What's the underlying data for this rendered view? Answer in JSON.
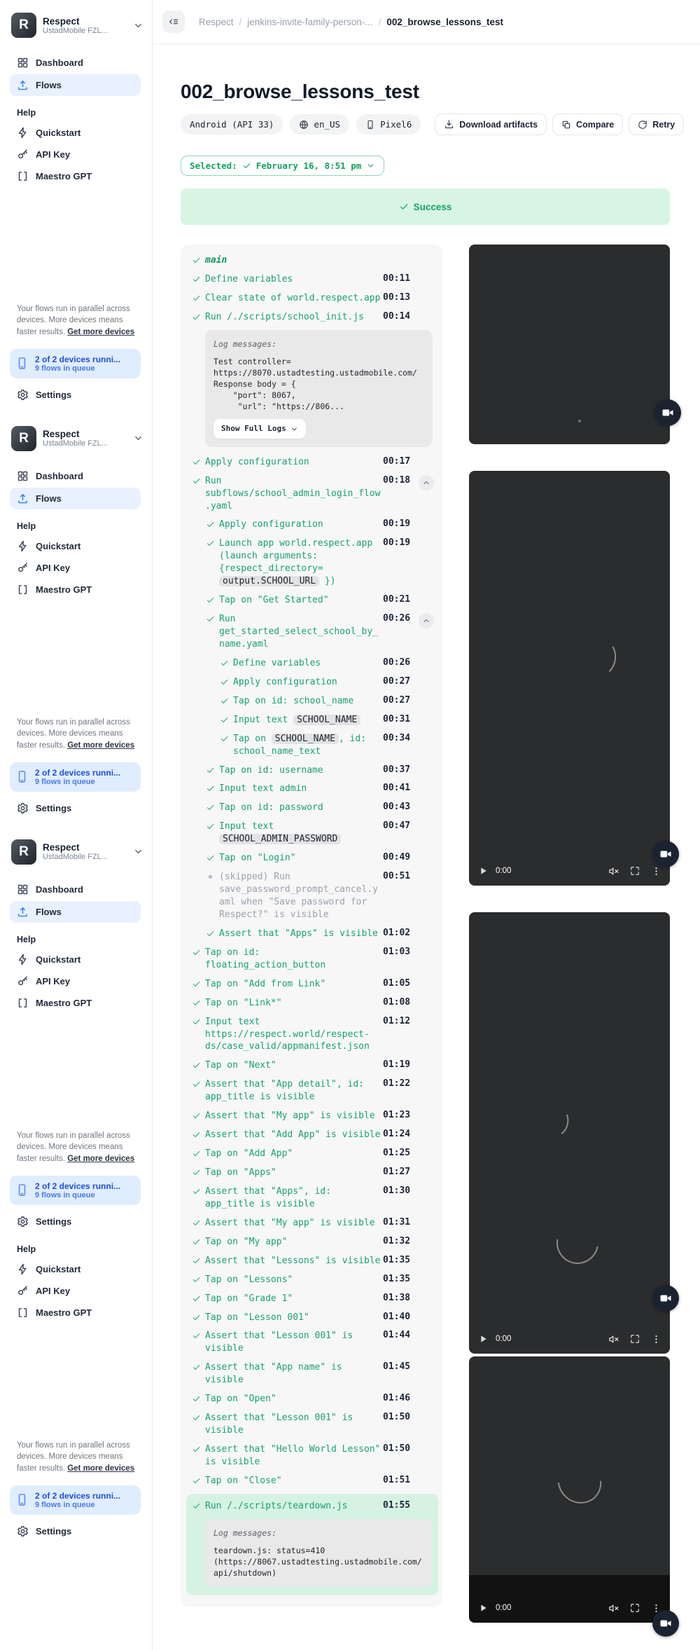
{
  "colors": {
    "accent_green": "#19a172",
    "success_bg": "#d8f5e4",
    "link_blue": "#2f7cf6",
    "device_box_bg": "#e0edfe",
    "flows_pill_bg": "#e8f1fd"
  },
  "sidebar": {
    "org_name": "Respect",
    "org_sub": "UstadMobile FZL...",
    "logo_letter": "R",
    "nav": [
      {
        "label": "Dashboard",
        "icon": "grid",
        "active": false
      },
      {
        "label": "Flows",
        "icon": "upload",
        "active": true
      }
    ],
    "help_label": "Help",
    "help": [
      {
        "label": "Quickstart",
        "icon": "bolt"
      },
      {
        "label": "API Key",
        "icon": "key"
      },
      {
        "label": "Maestro GPT",
        "icon": "brackets"
      }
    ],
    "footer_text": "Your flows run in parallel across devices. More devices means faster results. ",
    "footer_link": "Get more devices",
    "device_title": "2 of 2 devices runni...",
    "device_sub": "9 flows in queue",
    "settings_label": "Settings",
    "blocks": [
      {
        "org": true
      },
      {
        "org": true
      },
      {
        "org": true
      },
      {
        "org": false
      }
    ]
  },
  "breadcrumb": {
    "items": [
      "Respect",
      "jenkins-invite-family-person-...",
      "002_browse_lessons_test"
    ]
  },
  "page": {
    "title": "002_browse_lessons_test",
    "badges": [
      {
        "label": "Android (API 33)",
        "icon": null
      },
      {
        "label": "en_US",
        "icon": "globe"
      },
      {
        "label": "Pixel6",
        "icon": "phone"
      }
    ],
    "actions": [
      {
        "label": "Download artifacts",
        "icon": "download"
      },
      {
        "label": "Compare",
        "icon": "compare"
      },
      {
        "label": "Retry",
        "icon": "retry"
      }
    ],
    "selected_prefix": "Selected:",
    "selected_value": "February 16, 8:51 pm",
    "status_label": "Success"
  },
  "steps": [
    {
      "lv": 0,
      "head": true,
      "text": [
        {
          "t": "main"
        }
      ]
    },
    {
      "lv": 0,
      "text": [
        {
          "t": "Define variables"
        }
      ],
      "time": "00:11"
    },
    {
      "lv": 0,
      "text": [
        {
          "t": "Clear state of world.respect.app"
        }
      ],
      "time": "00:13"
    },
    {
      "lv": 0,
      "text": [
        {
          "t": "Run /./scripts/school_init.js"
        }
      ],
      "time": "00:14",
      "log": {
        "label": "Log messages:",
        "lines": [
          "Test controller=",
          "https://8070.ustadtesting.ustadmobile.com/",
          "Response body = {",
          "    \"port\": 8067,",
          "     \"url\": \"https://806..."
        ],
        "button": "Show Full Logs"
      }
    },
    {
      "lv": 0,
      "text": [
        {
          "t": "Apply configuration"
        }
      ],
      "time": "00:17"
    },
    {
      "lv": 0,
      "text": [
        {
          "t": "Run subflows/school_admin_login_flow.yaml"
        }
      ],
      "time": "00:18",
      "chev": true
    },
    {
      "lv": 1,
      "text": [
        {
          "t": "Apply configuration"
        }
      ],
      "time": "00:19"
    },
    {
      "lv": 1,
      "text": [
        {
          "t": "Launch app world.respect.app (launch arguments: {respect_directory= "
        },
        {
          "c": "output.SCHOOL_URL"
        },
        {
          "t": " })"
        }
      ],
      "time": "00:19"
    },
    {
      "lv": 1,
      "text": [
        {
          "t": "Tap on \"Get Started\""
        }
      ],
      "time": "00:21"
    },
    {
      "lv": 1,
      "text": [
        {
          "t": "Run get_started_select_school_by_name.yaml"
        }
      ],
      "time": "00:26",
      "chev": true
    },
    {
      "lv": 2,
      "text": [
        {
          "t": "Define variables"
        }
      ],
      "time": "00:26"
    },
    {
      "lv": 2,
      "text": [
        {
          "t": "Apply configuration"
        }
      ],
      "time": "00:27"
    },
    {
      "lv": 2,
      "text": [
        {
          "t": "Tap on id: school_name"
        }
      ],
      "time": "00:27"
    },
    {
      "lv": 2,
      "text": [
        {
          "t": "Input text "
        },
        {
          "c": "SCHOOL_NAME"
        }
      ],
      "time": "00:31"
    },
    {
      "lv": 2,
      "text": [
        {
          "t": "Tap on "
        },
        {
          "c": "SCHOOL_NAME"
        },
        {
          "t": ", id: school_name_text"
        }
      ],
      "time": "00:34"
    },
    {
      "lv": 1,
      "text": [
        {
          "t": "Tap on id: username"
        }
      ],
      "time": "00:37"
    },
    {
      "lv": 1,
      "text": [
        {
          "t": "Input text admin"
        }
      ],
      "time": "00:41"
    },
    {
      "lv": 1,
      "text": [
        {
          "t": "Tap on id: password"
        }
      ],
      "time": "00:43"
    },
    {
      "lv": 1,
      "text": [
        {
          "t": "Input text "
        },
        {
          "c": "SCHOOL_ADMIN_PASSWORD"
        }
      ],
      "time": "00:47"
    },
    {
      "lv": 1,
      "text": [
        {
          "t": "Tap on \"Login\""
        }
      ],
      "time": "00:49"
    },
    {
      "lv": 1,
      "skip": true,
      "text": [
        {
          "t": "(skipped) Run save_password_prompt_cancel.yaml when \"Save password for Respect?\" is visible"
        }
      ],
      "time": "00:51"
    },
    {
      "lv": 1,
      "text": [
        {
          "t": "Assert that \"Apps\" is visible"
        }
      ],
      "time": "01:02"
    },
    {
      "lv": 0,
      "text": [
        {
          "t": "Tap on id: floating_action_button"
        }
      ],
      "time": "01:03"
    },
    {
      "lv": 0,
      "text": [
        {
          "t": "Tap on \"Add from Link\""
        }
      ],
      "time": "01:05"
    },
    {
      "lv": 0,
      "text": [
        {
          "t": "Tap on \"Link*\""
        }
      ],
      "time": "01:08"
    },
    {
      "lv": 0,
      "text": [
        {
          "t": "Input text https://respect.world/respect-ds/case_valid/appmanifest.json"
        }
      ],
      "time": "01:12"
    },
    {
      "lv": 0,
      "text": [
        {
          "t": "Tap on \"Next\""
        }
      ],
      "time": "01:19"
    },
    {
      "lv": 0,
      "text": [
        {
          "t": "Assert that \"App detail\", id: app_title is visible"
        }
      ],
      "time": "01:22"
    },
    {
      "lv": 0,
      "text": [
        {
          "t": "Assert that \"My app\" is visible"
        }
      ],
      "time": "01:23"
    },
    {
      "lv": 0,
      "text": [
        {
          "t": "Assert that \"Add App\" is visible"
        }
      ],
      "time": "01:24"
    },
    {
      "lv": 0,
      "text": [
        {
          "t": "Tap on \"Add App\""
        }
      ],
      "time": "01:25"
    },
    {
      "lv": 0,
      "text": [
        {
          "t": "Tap on \"Apps\""
        }
      ],
      "time": "01:27"
    },
    {
      "lv": 0,
      "text": [
        {
          "t": "Assert that \"Apps\", id: app_title is visible"
        }
      ],
      "time": "01:30"
    },
    {
      "lv": 0,
      "text": [
        {
          "t": "Assert that \"My app\" is visible"
        }
      ],
      "time": "01:31"
    },
    {
      "lv": 0,
      "text": [
        {
          "t": "Tap on \"My app\""
        }
      ],
      "time": "01:32"
    },
    {
      "lv": 0,
      "text": [
        {
          "t": "Assert that \"Lessons\" is visible"
        }
      ],
      "time": "01:35"
    },
    {
      "lv": 0,
      "text": [
        {
          "t": "Tap on \"Lessons\""
        }
      ],
      "time": "01:35"
    },
    {
      "lv": 0,
      "text": [
        {
          "t": "Tap on \"Grade 1\""
        }
      ],
      "time": "01:38"
    },
    {
      "lv": 0,
      "text": [
        {
          "t": "Tap on \"Lesson 001\""
        }
      ],
      "time": "01:40"
    },
    {
      "lv": 0,
      "text": [
        {
          "t": "Assert that \"Lesson 001\" is visible"
        }
      ],
      "time": "01:44"
    },
    {
      "lv": 0,
      "text": [
        {
          "t": "Assert that \"App name\" is visible"
        }
      ],
      "time": "01:45"
    },
    {
      "lv": 0,
      "text": [
        {
          "t": "Tap on \"Open\""
        }
      ],
      "time": "01:46"
    },
    {
      "lv": 0,
      "text": [
        {
          "t": "Assert that \"Lesson 001\" is visible"
        }
      ],
      "time": "01:50"
    },
    {
      "lv": 0,
      "text": [
        {
          "t": "Assert that \"Hello World Lesson\" is visible"
        }
      ],
      "time": "01:50"
    },
    {
      "lv": 0,
      "text": [
        {
          "t": "Tap on \"Close\""
        }
      ],
      "time": "01:51"
    },
    {
      "lv": 0,
      "hl": true,
      "text": [
        {
          "t": "Run /./scripts/teardown.js"
        }
      ],
      "time": "01:55",
      "log": {
        "label": "Log messages:",
        "lines": [
          "teardown.js: status=410",
          "(https://8067.ustadtesting.ustadmobile.com/api/shutdown)"
        ],
        "button": null
      }
    }
  ],
  "videos": [
    {
      "time": null
    },
    {
      "time": "0:00"
    },
    {
      "time": "0:00"
    },
    {
      "time": "0:00"
    }
  ]
}
